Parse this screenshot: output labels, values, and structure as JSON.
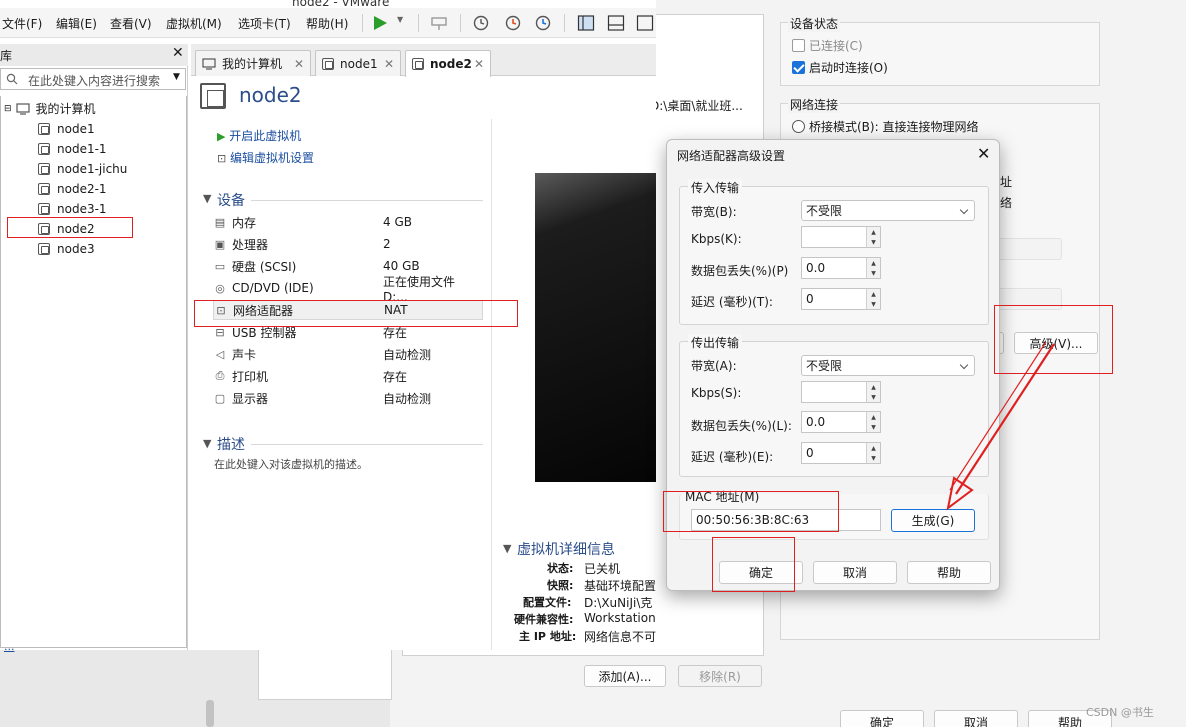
{
  "window_title": "node2 - VMware",
  "menubar": {
    "items": [
      "文件(F)",
      "编辑(E)",
      "查看(V)",
      "虚拟机(M)",
      "选项卡(T)",
      "帮助(H)"
    ]
  },
  "library": {
    "title": "库",
    "search_placeholder": "在此处键入内容进行搜索",
    "root": "我的计算机",
    "vms": [
      "node1",
      "node1-1",
      "node1-jichu",
      "node2-1",
      "node3-1",
      "node2",
      "node3"
    ],
    "bottom_link": "..."
  },
  "tabs": [
    {
      "label": "我的计算机"
    },
    {
      "label": "node1"
    },
    {
      "label": "node2"
    }
  ],
  "vm": {
    "title": "node2",
    "actions": [
      "开启此虚拟机",
      "编辑虚拟机设置"
    ],
    "devices_title": "设备",
    "devices": [
      {
        "name": "内存",
        "value": "4 GB",
        "icon": "memory-icon",
        "glyph": "▤"
      },
      {
        "name": "处理器",
        "value": "2",
        "icon": "cpu-icon",
        "glyph": "▣"
      },
      {
        "name": "硬盘 (SCSI)",
        "value": "40 GB",
        "icon": "disk-icon",
        "glyph": "▭"
      },
      {
        "name": "CD/DVD (IDE)",
        "value": "正在使用文件 D:...",
        "icon": "cd-icon",
        "glyph": "◎"
      },
      {
        "name": "网络适配器",
        "value": "NAT",
        "icon": "network-icon",
        "glyph": "⊡"
      },
      {
        "name": "USB 控制器",
        "value": "存在",
        "icon": "usb-icon",
        "glyph": "⊟"
      },
      {
        "name": "声卡",
        "value": "自动检测",
        "icon": "sound-icon",
        "glyph": "◁"
      },
      {
        "name": "打印机",
        "value": "存在",
        "icon": "printer-icon",
        "glyph": "⎙"
      },
      {
        "name": "显示器",
        "value": "自动检测",
        "icon": "display-icon",
        "glyph": "▢"
      }
    ],
    "desc_title": "描述",
    "desc_placeholder": "在此处键入对该虚拟机的描述。",
    "details_title": "虚拟机详细信息",
    "details": [
      {
        "label": "状态:",
        "value": "已关机"
      },
      {
        "label": "快照:",
        "value": "基础环境配置"
      },
      {
        "label": "配置文件:",
        "value": "D:\\XuNiJi\\克"
      },
      {
        "label": "硬件兼容性:",
        "value": "Workstation"
      },
      {
        "label": "主 IP 地址:",
        "value": "网络信息不可"
      }
    ]
  },
  "settings": {
    "path_fragment": "D:\\桌面\\就业班...",
    "device_status_title": "设备状态",
    "connected_label": "已连接(C)",
    "connect_on_start_label": "启动时连接(O)",
    "network_title": "网络连接",
    "bridged_label": "桥接模式(B): 直接连接物理网络",
    "frag1": "址",
    "frag2": "络",
    "advanced_button": "高级(V)...",
    "add_button": "添加(A)...",
    "remove_button": "移除(R)",
    "ok_button": "确定",
    "cancel_button": "取消",
    "help_button": "帮助"
  },
  "dialog": {
    "title": "网络适配器高级设置",
    "incoming_title": "传入传输",
    "outgoing_title": "传出传输",
    "bandwidth_in_label": "带宽(B):",
    "bandwidth_in_value": "不受限",
    "kbps_in_label": "Kbps(K):",
    "kbps_in_value": "",
    "loss_in_label": "数据包丢失(%)(P)",
    "loss_in_value": "0.0",
    "latency_in_label": "延迟 (毫秒)(T):",
    "latency_in_value": "0",
    "bandwidth_out_label": "带宽(A):",
    "bandwidth_out_value": "不受限",
    "kbps_out_label": "Kbps(S):",
    "kbps_out_value": "",
    "loss_out_label": "数据包丢失(%)(L):",
    "loss_out_value": "0.0",
    "latency_out_label": "延迟 (毫秒)(E):",
    "latency_out_value": "0",
    "mac_title": "MAC 地址(M)",
    "mac_value": "00:50:56:3B:8C:63",
    "generate_button": "生成(G)",
    "ok_button": "确定",
    "cancel_button": "取消",
    "help_button": "帮助"
  },
  "watermark": "CSDN @书生",
  "colors": {
    "accent": "#1a73d9",
    "annotation_red": "#e02020",
    "link": "#1c4fa0"
  }
}
